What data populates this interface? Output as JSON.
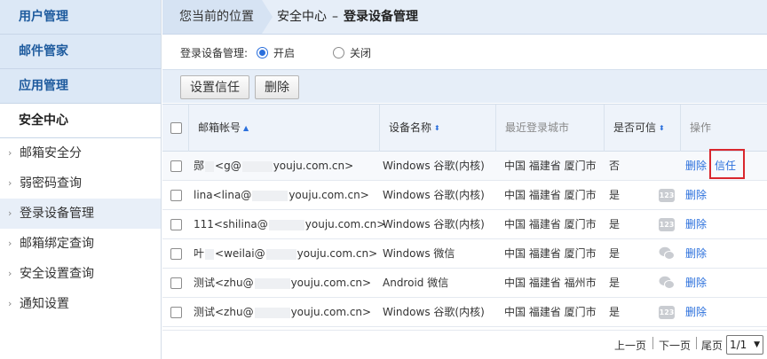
{
  "sidebar": {
    "top_items": [
      {
        "label": "用户管理"
      },
      {
        "label": "邮件管家"
      },
      {
        "label": "应用管理"
      },
      {
        "label": "安全中心"
      }
    ],
    "sub_items": [
      {
        "label": "邮箱安全分"
      },
      {
        "label": "弱密码查询"
      },
      {
        "label": "登录设备管理"
      },
      {
        "label": "邮箱绑定查询"
      },
      {
        "label": "安全设置查询"
      },
      {
        "label": "通知设置"
      }
    ]
  },
  "breadcrumb": {
    "here_label": "您当前的位置",
    "section": "安全中心",
    "separator": "–",
    "page": "登录设备管理"
  },
  "filter": {
    "label": "登录设备管理:",
    "options": [
      {
        "label": "开启",
        "selected": true
      },
      {
        "label": "关闭",
        "selected": false
      }
    ]
  },
  "toolbar": {
    "trust_label": "设置信任",
    "delete_label": "删除"
  },
  "table": {
    "headers": {
      "email": "邮箱帐号",
      "device": "设备名称",
      "city": "最近登录城市",
      "trusted": "是否可信",
      "actions": "操作"
    },
    "rows": [
      {
        "email_prefix": "郧",
        "email_mid": "<g@",
        "email_suffix": "youju.com.cn>",
        "device": "Windows 谷歌(内核)",
        "city": "中国 福建省 厦门市",
        "trusted": "否",
        "icon": "",
        "delete_label": "删除",
        "trust_label": "信任"
      },
      {
        "email_prefix": "lina<lina@",
        "email_mid": "",
        "email_suffix": "youju.com.cn>",
        "device": "Windows 谷歌(内核)",
        "city": "中国 福建省 厦门市",
        "trusted": "是",
        "icon": "123",
        "delete_label": "删除",
        "trust_label": ""
      },
      {
        "email_prefix": "111<shilina@",
        "email_mid": "",
        "email_suffix": "youju.com.cn>",
        "device": "Windows 谷歌(内核)",
        "city": "中国 福建省 厦门市",
        "trusted": "是",
        "icon": "123",
        "delete_label": "删除",
        "trust_label": ""
      },
      {
        "email_prefix": "叶",
        "email_mid": "<weilai@",
        "email_suffix": "youju.com.cn>",
        "device": "Windows 微信",
        "city": "中国 福建省 厦门市",
        "trusted": "是",
        "icon": "wechat",
        "delete_label": "删除",
        "trust_label": ""
      },
      {
        "email_prefix": "测试<zhu@",
        "email_mid": "",
        "email_suffix": "youju.com.cn>",
        "device": "Android 微信",
        "city": "中国 福建省 福州市",
        "trusted": "是",
        "icon": "wechat",
        "delete_label": "删除",
        "trust_label": ""
      },
      {
        "email_prefix": "测试<zhu@",
        "email_mid": "",
        "email_suffix": "youju.com.cn>",
        "device": "Windows 谷歌(内核)",
        "city": "中国 福建省 厦门市",
        "trusted": "是",
        "icon": "123",
        "delete_label": "删除",
        "trust_label": ""
      }
    ]
  },
  "pager": {
    "prev_label": "上一页",
    "next_label": "下一页",
    "last_label": "尾页",
    "page_value": "1/1"
  },
  "colors": {
    "accent": "#2a6fdc",
    "highlight_border": "#d9272e",
    "sidebar_top_bg": "#dce8f6"
  }
}
